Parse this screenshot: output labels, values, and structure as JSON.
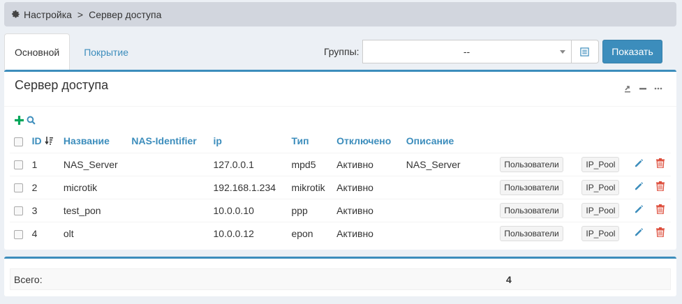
{
  "breadcrumb": {
    "root": "Настройка",
    "separator": ">",
    "current": "Сервер доступа"
  },
  "tabs": [
    {
      "label": "Основной",
      "active": true
    },
    {
      "label": "Покрытие",
      "active": false
    }
  ],
  "groups": {
    "label": "Группы:",
    "selected": "--"
  },
  "show_button": "Показать",
  "box": {
    "title": "Сервер доступа"
  },
  "table": {
    "headers": {
      "id": "ID",
      "name": "Название",
      "nas_identifier": "NAS-Identifier",
      "ip": "ip",
      "type": "Тип",
      "disabled": "Отключено",
      "description": "Описание"
    },
    "rows": [
      {
        "id": "1",
        "name": "NAS_Server",
        "nas_identifier": "",
        "ip": "127.0.0.1",
        "type": "mpd5",
        "status": "Активно",
        "description": "NAS_Server",
        "users_btn": "Пользователи",
        "pool_btn": "IP_Pool"
      },
      {
        "id": "2",
        "name": "microtik",
        "nas_identifier": "",
        "ip": "192.168.1.234",
        "type": "mikrotik",
        "status": "Активно",
        "description": "",
        "users_btn": "Пользователи",
        "pool_btn": "IP_Pool"
      },
      {
        "id": "3",
        "name": "test_pon",
        "nas_identifier": "",
        "ip": "10.0.0.10",
        "type": "ppp",
        "status": "Активно",
        "description": "",
        "users_btn": "Пользователи",
        "pool_btn": "IP_Pool"
      },
      {
        "id": "4",
        "name": "olt",
        "nas_identifier": "",
        "ip": "10.0.0.12",
        "type": "epon",
        "status": "Активно",
        "description": "",
        "users_btn": "Пользователи",
        "pool_btn": "IP_Pool"
      }
    ]
  },
  "footer": {
    "label": "Всего:",
    "value": "4"
  },
  "colors": {
    "accent": "#3c8dbc",
    "add": "#00a65a",
    "delete": "#dd4b39"
  }
}
